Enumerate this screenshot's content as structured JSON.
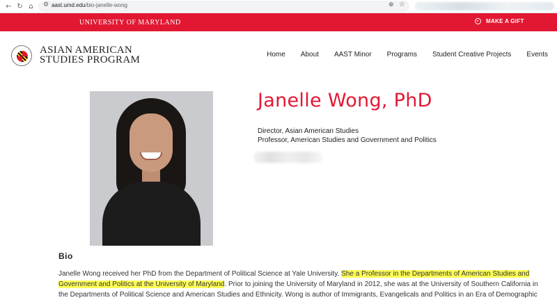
{
  "browser": {
    "url_host": "aast.umd.edu",
    "url_path": "/bio-janelle-wong",
    "back_icon": "arrow-left",
    "reload_icon": "reload",
    "home_icon": "home",
    "zoom_icon": "magnifier",
    "bookmark_icon": "star"
  },
  "top_bar": {
    "university": "UNIVERSITY OF MARYLAND",
    "gift_label": "MAKE A GIFT",
    "color": "#e21833"
  },
  "header": {
    "title_line1": "ASIAN AMERICAN",
    "title_line2": "STUDIES PROGRAM",
    "nav": [
      "Home",
      "About",
      "AAST Minor",
      "Programs",
      "Student Creative Projects",
      "Events"
    ]
  },
  "profile": {
    "name": "Janelle Wong, PhD",
    "role1": "Director, Asian American Studies",
    "role2": "Professor, American Studies and Government and Politics"
  },
  "bio": {
    "heading": "Bio",
    "part1": "Janelle Wong received her PhD from the Department of Political Science at Yale University. ",
    "highlight": "She a Professor in the Departments of American Studies and Government and Politics at the University of Maryland",
    "part2": ". Prior to joining the University of Maryland in 2012, she was at the University of Southern California in the Departments of Political Science and American Studies and Ethnicity. Wong is author of Immigrants, Evangelicals and Politics in an Era of Demographic",
    "highlight_color": "#fdfd55"
  }
}
